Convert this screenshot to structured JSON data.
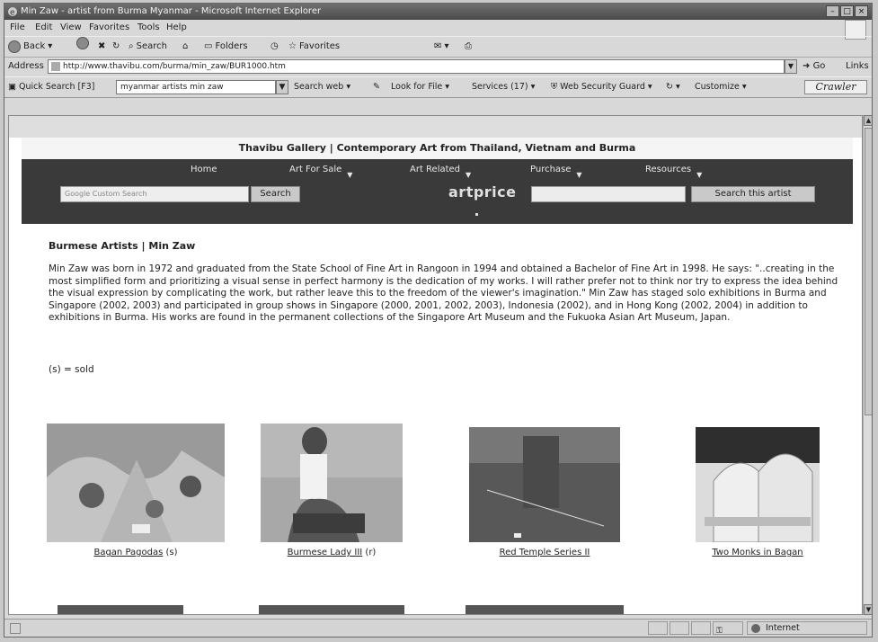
{
  "window": {
    "title": "Min Zaw - artist from Burma Myanmar - Microsoft Internet Explorer",
    "buttons": [
      "–",
      "□",
      "×"
    ]
  },
  "menu": [
    "File",
    "Edit",
    "View",
    "Favorites",
    "Tools",
    "Help"
  ],
  "toolbar": {
    "back": "Back",
    "search": "Search",
    "folders": "Folders",
    "favorites": "Favorites"
  },
  "address": {
    "label": "Address",
    "url": "http://www.thavibu.com/burma/min_zaw/BUR1000.htm",
    "go": "Go",
    "links": "Links"
  },
  "linksbar": {
    "quick_search": "Quick Search [F3]",
    "query": "myanmar artists min zaw",
    "search_web": "Search web",
    "look_for_file": "Look for File",
    "services": "Services (17)",
    "web_security_guard": "Web Security Guard",
    "customize": "Customize",
    "crawler": "Crawler"
  },
  "site": {
    "header": "Thavibu Gallery | Contemporary Art from Thailand, Vietnam and Burma",
    "nav": [
      "Home",
      "Art For Sale",
      "Art Related",
      "Purchase",
      "Resources"
    ],
    "google_placeholder": "Google Custom Search",
    "search_button": "Search",
    "artprice": "artprice",
    "search_artist_button": "Search this artist"
  },
  "page": {
    "title": "Burmese Artists | Min Zaw",
    "bio": "Min Zaw was born in 1972 and graduated from the State School of Fine Art in Rangoon in 1994 and obtained a Bachelor of Fine Art in 1998.  He says: \"..creating in the most simplified form and prioritizing a visual sense in perfect harmony is the dedication of my works.  I will rather prefer not to think nor try to express the idea behind the visual expression by complicating the work, but rather leave this to the freedom of the viewer's imagination.\"  Min Zaw has staged solo exhibitions in Burma and Singapore (2002, 2003) and participated in group shows in Singapore (2000, 2001, 2002, 2003), Indonesia (2002), and in Hong Kong (2002, 2004) in addition to exhibitions in Burma. His works are found in the permanent collections of the Singapore Art Museum and the Fukuoka Asian Art Museum, Japan.",
    "sold_note": "(s) = sold"
  },
  "artworks": [
    {
      "title": "Bagan Pagodas",
      "suffix": " (s)"
    },
    {
      "title": "Burmese Lady III",
      "suffix": " (r)"
    },
    {
      "title": "Red Temple Series II",
      "suffix": ""
    },
    {
      "title": "Two Monks in Bagan",
      "suffix": ""
    }
  ],
  "status": {
    "zone": "Internet"
  }
}
